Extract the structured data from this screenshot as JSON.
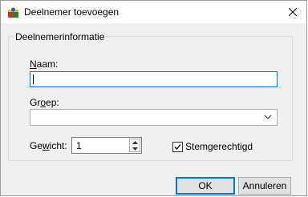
{
  "window": {
    "title": "Deelnemer toevoegen"
  },
  "group": {
    "title": "Deelnemerinformatie"
  },
  "fields": {
    "name": {
      "label_accel": "N",
      "label_rest": "aam:",
      "value": ""
    },
    "group": {
      "label_pre": "Gr",
      "label_accel": "o",
      "label_post": "ep:",
      "value": ""
    },
    "weight": {
      "label_pre": "Ge",
      "label_accel": "w",
      "label_post": "icht:",
      "value": "1"
    }
  },
  "checkbox": {
    "label": "Stemgerechtigd",
    "checked": true
  },
  "buttons": {
    "ok": "OK",
    "cancel": "Annuleren"
  },
  "icons": {
    "app": "app-icon",
    "close": "close-icon",
    "dropdown": "chevron-down-icon",
    "spin_up": "spin-up-icon",
    "spin_down": "spin-down-icon",
    "check": "check-icon"
  },
  "colors": {
    "focus": "#0078d7",
    "dialog_bg": "#f0f0f0"
  }
}
